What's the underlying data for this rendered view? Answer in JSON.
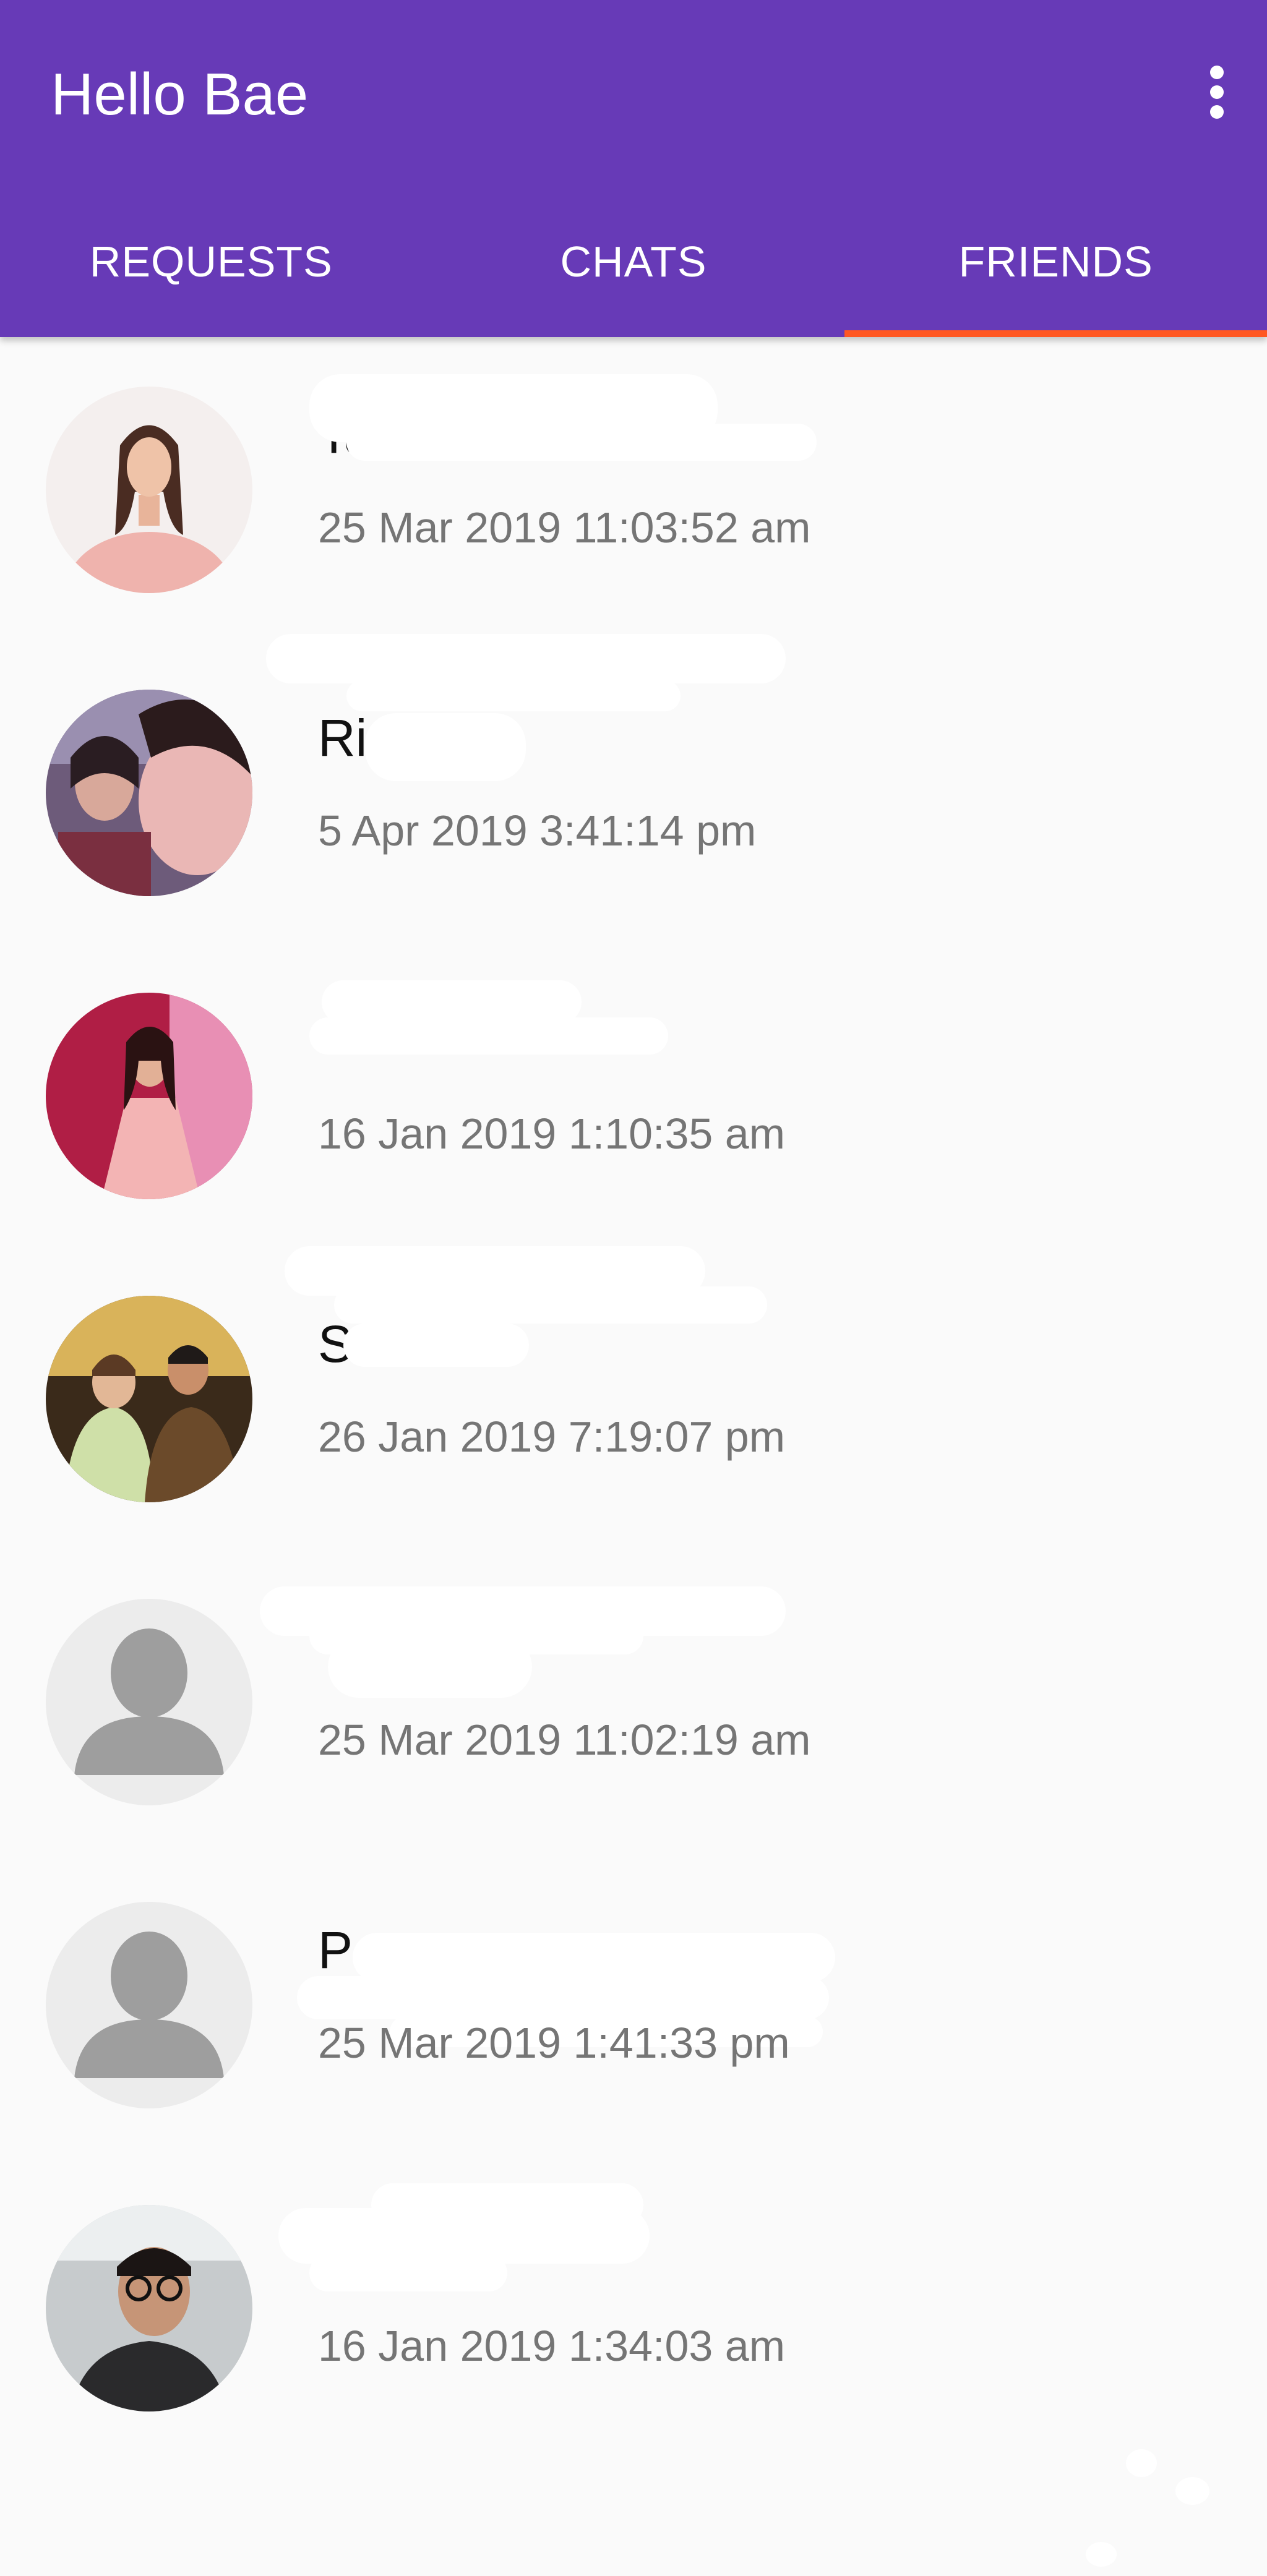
{
  "app": {
    "title": "Hello Bae",
    "accent_color": "#673ab7",
    "indicator_color": "#ff5722",
    "overflow_icon": "more-vert-icon"
  },
  "tabs": [
    {
      "label": "REQUESTS",
      "active": false
    },
    {
      "label": "CHATS",
      "active": false
    },
    {
      "label": "FRIENDS",
      "active": true
    }
  ],
  "friends": [
    {
      "name": "Ta",
      "timestamp": "25 Mar 2019 11:03:52 am",
      "avatar": "photo-woman-pink"
    },
    {
      "name": "Ri",
      "timestamp": "5 Apr 2019 3:41:14 pm",
      "avatar": "photo-selfie-two"
    },
    {
      "name": "",
      "timestamp": "16 Jan 2019 1:10:35 am",
      "avatar": "photo-woman-red"
    },
    {
      "name": "S",
      "timestamp": "26 Jan 2019 7:19:07 pm",
      "avatar": "photo-couple"
    },
    {
      "name": "",
      "timestamp": "25 Mar 2019 11:02:19 am",
      "avatar": "default-person-icon"
    },
    {
      "name": "P",
      "timestamp": "25 Mar 2019 1:41:33 pm",
      "avatar": "default-person-icon"
    },
    {
      "name": "",
      "timestamp": "16 Jan 2019 1:34:03 am",
      "avatar": "photo-man-glasses"
    }
  ]
}
